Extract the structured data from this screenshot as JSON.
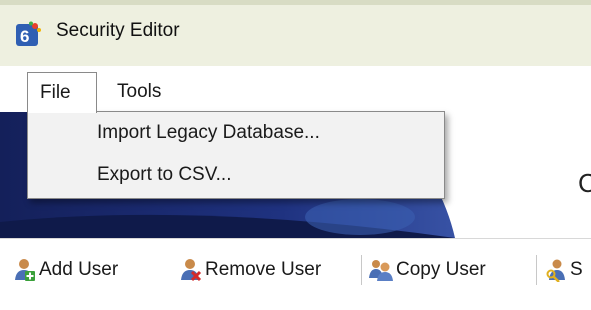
{
  "window": {
    "title": "Security Editor",
    "icon": "app-logo-icon"
  },
  "menubar": {
    "file_label": "File",
    "tools_label": "Tools"
  },
  "file_menu": {
    "items": [
      {
        "label": "Import Legacy Database..."
      },
      {
        "label": "Export to CSV..."
      }
    ]
  },
  "banner": {
    "partial_text": "C"
  },
  "toolbar": {
    "add_user_label": "Add User",
    "remove_user_label": "Remove User",
    "copy_user_label": "Copy User",
    "partial_label": "S",
    "icons": [
      "add-user-icon",
      "remove-user-icon",
      "copy-user-icon",
      "key-user-icon"
    ]
  },
  "colors": {
    "titlebar_bg": "#eef0e0",
    "banner_blue": "#1a2a6e",
    "menu_bg": "#f2f2f2"
  }
}
